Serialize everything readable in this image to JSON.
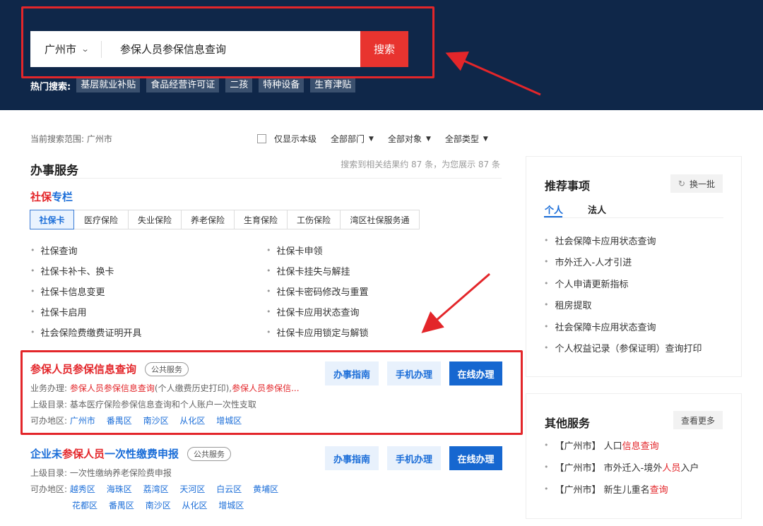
{
  "header": {
    "city": "广州市",
    "search_value": "参保人员参保信息查询",
    "search_button": "搜索",
    "hot_label": "热门搜索:",
    "hot_tags": [
      "基层就业补贴",
      "食品经营许可证",
      "二孩",
      "特种设备",
      "生育津贴"
    ]
  },
  "filters": {
    "scope_label": "当前搜索范围: 广州市",
    "only_level": "仅显示本级",
    "dept": "全部部门",
    "target": "全部对象",
    "type": "全部类型"
  },
  "main": {
    "section_title": "办事服务",
    "result_count": "搜索到相关结果约 87 条，为您展示 87 条",
    "shebao_title_red": "社保",
    "shebao_title_blue": "专栏",
    "tabs": [
      "社保卡",
      "医疗保险",
      "失业保险",
      "养老保险",
      "生育保险",
      "工伤保险",
      "湾区社保服务通"
    ],
    "links": [
      "社保查询",
      "社保卡申领",
      "社保卡补卡、换卡",
      "社保卡挂失与解挂",
      "社保卡信息变更",
      "社保卡密码修改与重置",
      "社保卡启用",
      "社保卡应用状态查询",
      "社会保险费缴费证明开具",
      "社保卡应用锁定与解锁"
    ]
  },
  "services": [
    {
      "title": "参保人员参保信息查询",
      "badge": "公共服务",
      "biz_label": "业务办理:",
      "biz_link1": "参保人员参保信息查询",
      "biz_text": "(个人缴费历史打印),",
      "biz_link2": "参保人员参保信...",
      "dir_label": "上级目录:",
      "dir_text": "基本医疗保险参保信息查询和个人账户一次性支取",
      "area_label": "可办地区:",
      "areas": [
        "广州市",
        "番禺区",
        "南沙区",
        "从化区",
        "增城区"
      ],
      "btn_guide": "办事指南",
      "btn_mobile": "手机办理",
      "btn_online": "在线办理"
    },
    {
      "title_blue1": "企业未",
      "title_red": "参保人员",
      "title_blue2": "一次性缴费申报",
      "badge": "公共服务",
      "dir_label": "上级目录:",
      "dir_text": "一次性缴纳养老保险费申报",
      "area_label": "可办地区:",
      "areas_row1": [
        "越秀区",
        "海珠区",
        "荔湾区",
        "天河区",
        "白云区",
        "黄埔区"
      ],
      "areas_row2": [
        "花都区",
        "番禺区",
        "南沙区",
        "从化区",
        "增城区"
      ],
      "btn_guide": "办事指南",
      "btn_mobile": "手机办理",
      "btn_online": "在线办理"
    }
  ],
  "recommend": {
    "title": "推荐事项",
    "refresh": "换一批",
    "tab_personal": "个人",
    "tab_legal": "法人",
    "items": [
      "社会保障卡应用状态查询",
      "市外迁入-人才引进",
      "个人申请更新指标",
      "租房提取",
      "社会保障卡应用状态查询",
      "个人权益记录（参保证明）查询打印"
    ]
  },
  "other": {
    "title": "其他服务",
    "more": "查看更多",
    "items": [
      {
        "prefix": "【广州市】 人口",
        "hl": "信息查询",
        "suffix": ""
      },
      {
        "prefix": "【广州市】 市外迁入-境外",
        "hl": "人员",
        "suffix": "入户"
      },
      {
        "prefix": "【广州市】 新生儿重名",
        "hl": "查询",
        "suffix": ""
      }
    ]
  },
  "colors": {
    "header_bg": "#0f2749",
    "accent_red": "#e3262a",
    "link_blue": "#1a6dd8",
    "button_blue": "#1667d0"
  }
}
